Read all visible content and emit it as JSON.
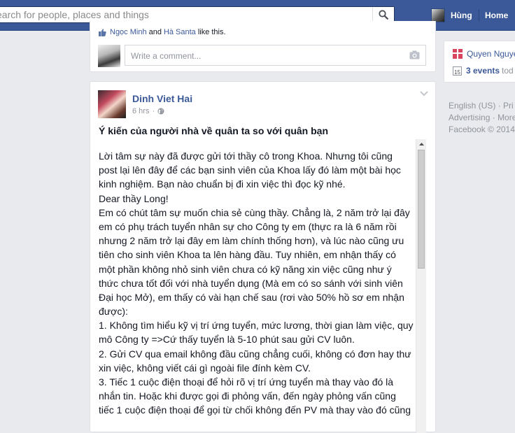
{
  "topbar": {
    "search_placeholder": "earch for people, places and things",
    "user_name": "Hùng",
    "home_label": "Home"
  },
  "prev_post": {
    "like_names": [
      "Ngọc Minh",
      "Hà Santa"
    ],
    "like_and": "and",
    "like_suffix": "like this.",
    "comment_placeholder": "Write a comment..."
  },
  "post": {
    "author": "Dinh Viet Hai",
    "time": "6 hrs",
    "title": "Ý kiến của người nhà về quân ta so với quân bạn",
    "lines": [
      "Lời tâm sự này đã được gửi tới thầy cô trong Khoa. Nhưng tôi cũng",
      "post lại lên đây để các bạn sinh viên của Khoa lấy đó làm một bài học",
      "kinh nghiệm. Bạn nào chuẩn bị đi xin việc thì đọc kỹ nhé.",
      "Dear thầy Long!",
      "Em có chút tâm sự muốn chia sẻ cùng thầy. Chẳng là, 2 năm trở lại đây",
      "em có phụ trách tuyển nhân sự cho Công ty em (thực ra là 6 năm rồi",
      "nhưng 2 năm trở lại đây em làm chính thống hơn), và lúc nào cũng ưu",
      "tiên cho sinh viên Khoa ta lên hàng đầu. Tuy nhiên, em nhận thấy có",
      "một phần không nhỏ sinh viên chưa có kỹ năng xin việc cũng như ý",
      "thức chưa tốt đối với nhà tuyển dụng (Mà em có so sánh với sinh viên",
      "Đại học Mở), em thấy có vài hạn chế sau (rơi vào 50% hồ sơ em nhận",
      "được):",
      "1. Không tìm hiểu kỹ vị trí ứng tuyển, mức lương, thời gian làm việc, quy",
      "mô Công ty =>Cứ thấy tuyển là 5-10 phút sau gửi CV luôn.",
      "2. Gửi CV qua email không đầu cũng chẳng cuối, không có đơn hay thư",
      "xin việc, không viết cái gì ngoài file đính kèm CV.",
      "3. Tiếc 1 cuộc điện thoại để hỏi rõ vị trí ứng tuyển mà thay vào đó là",
      "nhắn tin. Hoặc khi được gọi đi phỏng vấn, đến ngày phỏng vấn cũng",
      "tiếc 1 cuộc điện thoại để gọi từ chối không đến PV mà thay vào đó cũng"
    ]
  },
  "sidebar": {
    "birthday_name": "Quyen Nguye",
    "events_count": "3 events",
    "events_suffix": "tod",
    "calendar_day": "15"
  },
  "footer": {
    "line1_a": "English (US)",
    "line1_sep": "·",
    "line1_b": "Pri",
    "line2_a": "Advertising",
    "line2_sep": "·",
    "line2_b": "More",
    "line3": "Facebook © 2014"
  }
}
